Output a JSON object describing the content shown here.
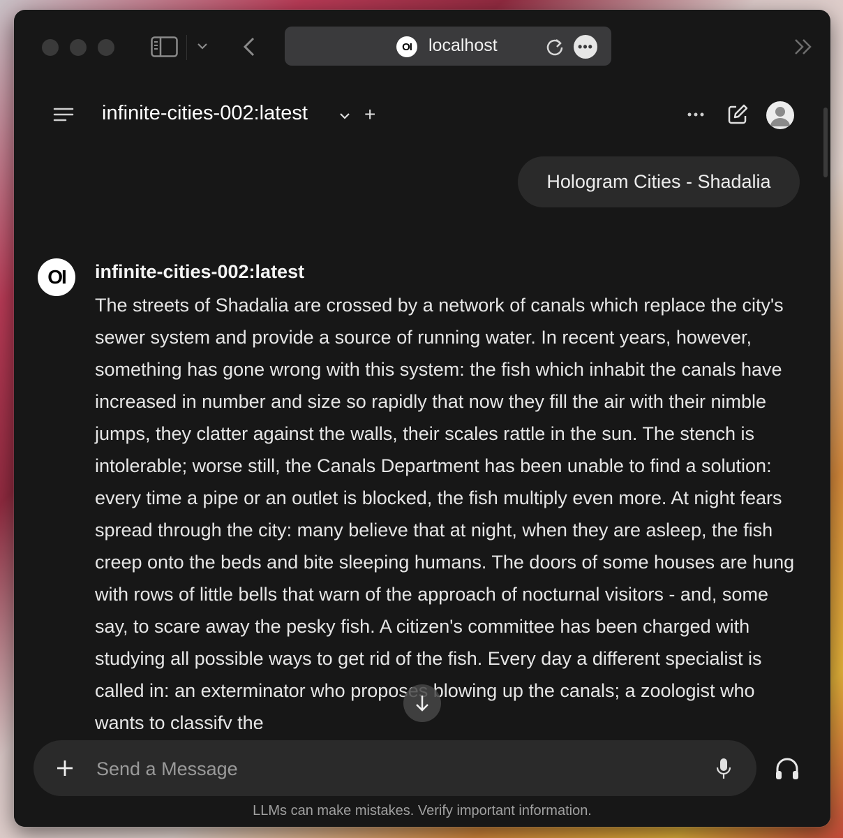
{
  "browser": {
    "url": "localhost",
    "site_logo_text": "OI"
  },
  "header": {
    "model_name": "infinite-cities-002:latest",
    "new_chat_symbol": "+"
  },
  "chat": {
    "user_message": "Hologram Cities - Shadalia",
    "assistant": {
      "avatar_text": "OI",
      "name": "infinite-cities-002:latest",
      "message": "The streets of Shadalia are crossed by a network of canals which replace the city's sewer system and provide a source of running water. In recent years, however, something has gone wrong with this system: the fish which inhabit the canals have increased in number and size so rapidly that now they fill the air with their nimble jumps, they clatter against the walls, their scales rattle in the sun. The stench is intolerable; worse still, the Canals Department has been unable to find a solution: every time a pipe or an outlet is blocked, the fish multiply even more. At night fears spread through the city: many believe that at night, when they are asleep, the fish creep onto the beds and bite sleeping humans. The doors of some houses are hung with rows of little bells that warn of the approach of nocturnal visitors - and, some say, to scare away the pesky fish. A citizen's committee has been charged with studying all possible ways to get rid of the fish. Every day a different specialist is called in: an exterminator who proposes blowing up the canals; a zoologist who wants to classify the"
    }
  },
  "composer": {
    "placeholder": "Send a Message",
    "value": ""
  },
  "footer": {
    "disclaimer": "LLMs can make mistakes. Verify important information."
  },
  "icons": {
    "sidebar_toggle": "sidebar-icon",
    "back": "chevron-left-icon",
    "reload": "reload-icon",
    "more": "more-icon",
    "forward_tabs": "double-chevron-right-icon",
    "menu": "menu-icon",
    "edit": "edit-icon",
    "mic": "microphone-icon",
    "voice": "headphones-icon"
  },
  "colors": {
    "background": "#171717",
    "bubble": "#2a2a2a",
    "text": "#e6e6e6",
    "muted": "#a0a0a0"
  }
}
